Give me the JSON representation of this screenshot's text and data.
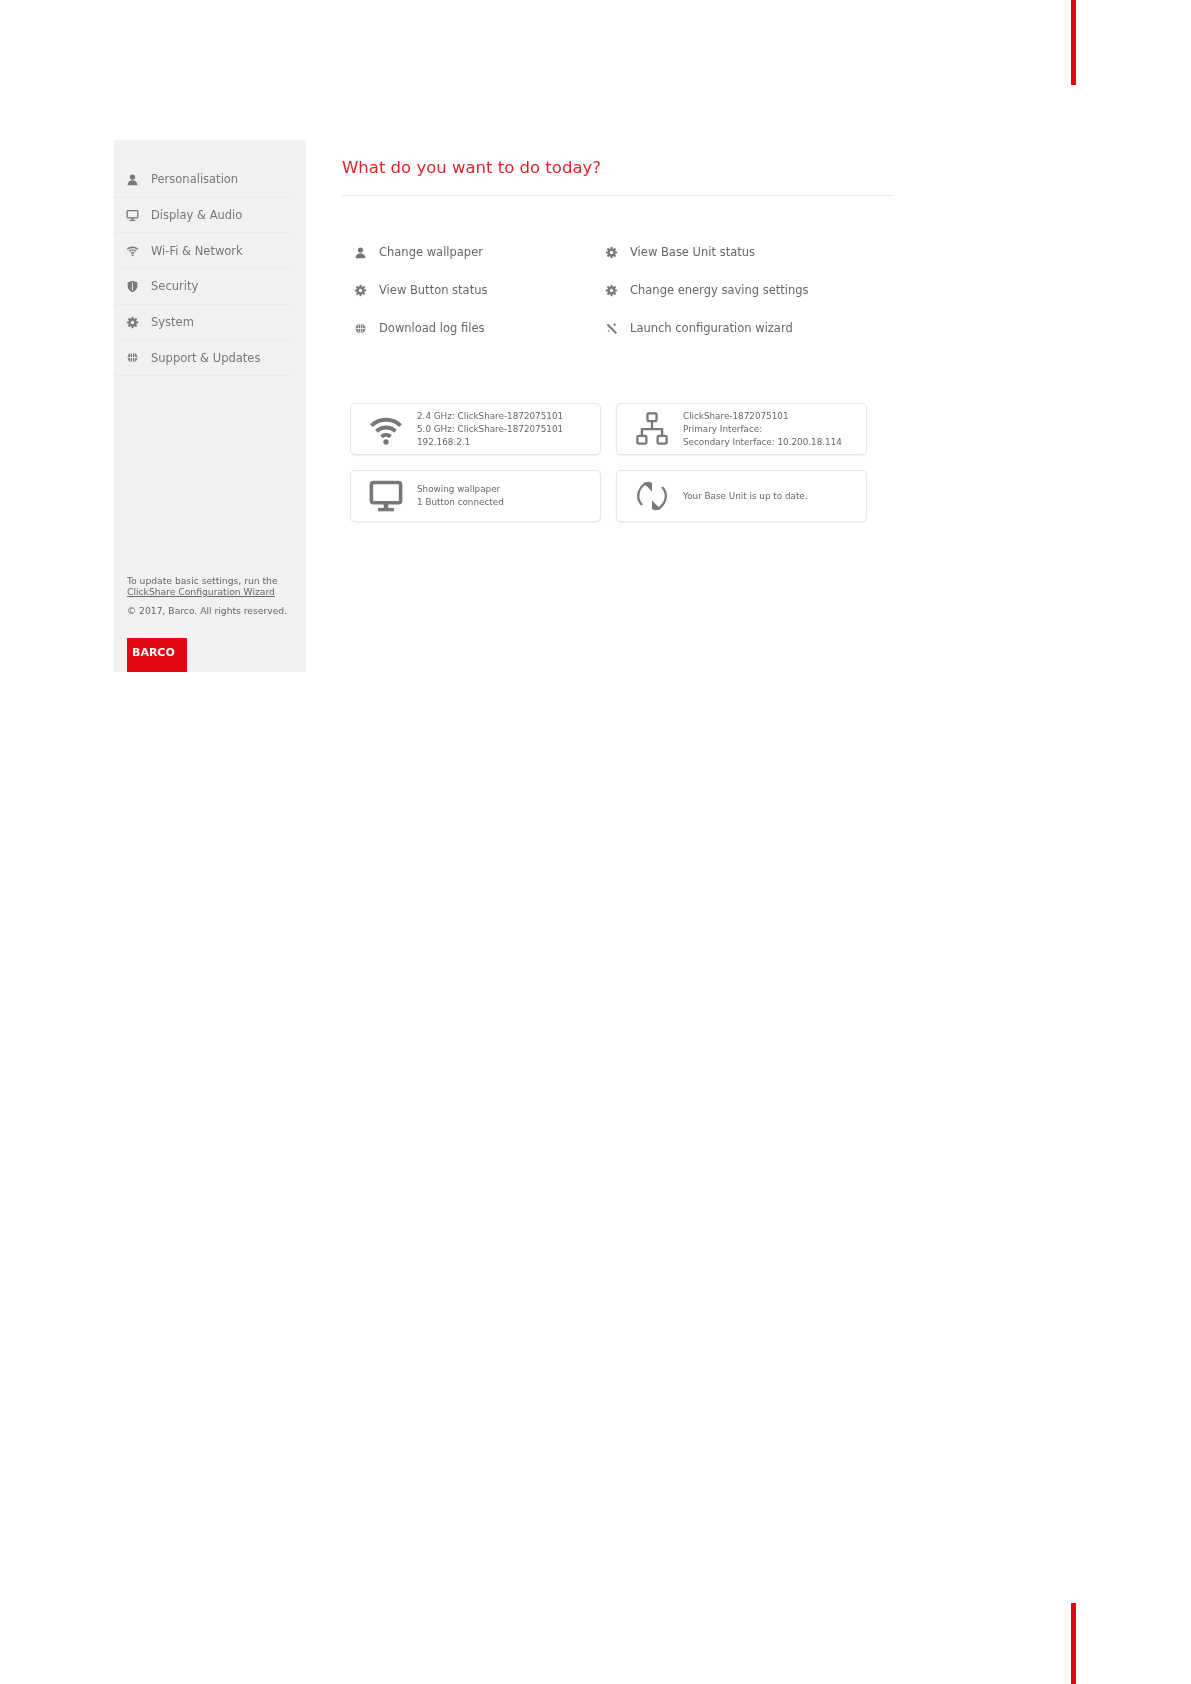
{
  "sidebar": {
    "items": [
      {
        "kind": "person",
        "label": "Personalisation"
      },
      {
        "kind": "monitor",
        "label": "Display & Audio"
      },
      {
        "kind": "wifi",
        "label": "Wi-Fi & Network"
      },
      {
        "kind": "shield",
        "label": "Security"
      },
      {
        "kind": "gear",
        "label": "System"
      },
      {
        "kind": "globe",
        "label": "Support & Updates"
      }
    ],
    "footer_text": "To update basic settings, run the",
    "footer_link": "ClickShare Configuration Wizard",
    "copyright": "© 2017, Barco. All rights reserved.",
    "logo": "BARCO"
  },
  "title": "What do you want to do today?",
  "actions": [
    {
      "kind": "person",
      "label": "Change wallpaper"
    },
    {
      "kind": "gear",
      "label": "View Base Unit status"
    },
    {
      "kind": "gear",
      "label": "View Button status"
    },
    {
      "kind": "gear",
      "label": "Change energy saving settings"
    },
    {
      "kind": "globe",
      "label": "Download log files"
    },
    {
      "kind": "wand",
      "label": "Launch configuration wizard"
    }
  ],
  "status_cards": [
    {
      "kind": "wifi",
      "lines": [
        "2.4 GHz: ClickShare-1872075101",
        "5.0 GHz: ClickShare-1872075101",
        "192.168.2.1"
      ]
    },
    {
      "kind": "network",
      "lines": [
        "ClickShare-1872075101",
        "Primary Interface:",
        "Secondary Interface: 10.200.18.114"
      ]
    },
    {
      "kind": "monitor",
      "lines": [
        "Showing wallpaper",
        "1 Button connected"
      ]
    },
    {
      "kind": "sync",
      "lines": [
        "Your Base Unit is up to date."
      ]
    }
  ]
}
